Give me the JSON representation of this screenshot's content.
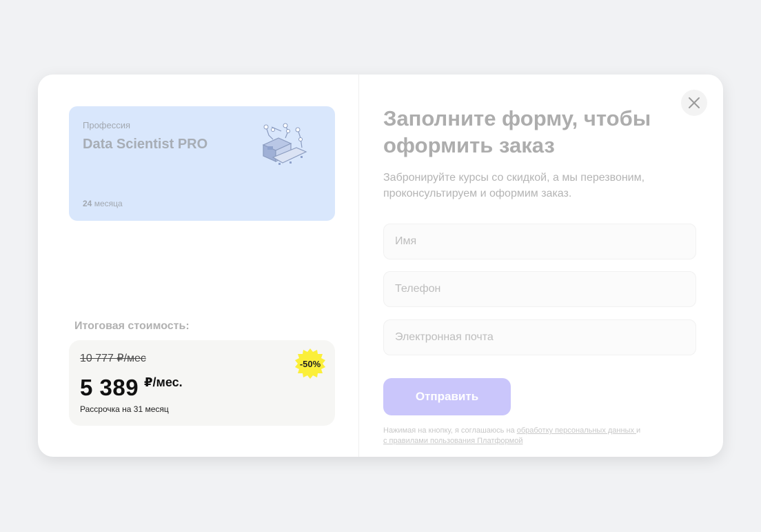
{
  "course": {
    "kicker": "Профессия",
    "title": "Data Scientist PRO",
    "duration_value": "24",
    "duration_unit": "месяца",
    "illustration_icon": "robot-arm-illustration"
  },
  "total": {
    "label": "Итоговая стоимость:",
    "old_price": "10 777 ₽/мес",
    "new_price": "5 389",
    "new_price_unit": "₽/мес.",
    "installment": "Рассрочка на 31 месяц",
    "discount": "-50%"
  },
  "form": {
    "title": "Заполните форму, чтобы оформить заказ",
    "subtitle": "Забронируйте курсы со скидкой, а мы перезвоним, проконсультируем и оформим заказ.",
    "name_placeholder": "Имя",
    "phone_placeholder": "Телефон",
    "email_placeholder": "Электронная почта",
    "submit_label": "Отправить",
    "consent_prefix": "Нажимая на кнопку, я соглашаюсь на ",
    "consent_link1": "обработку персональных данных ",
    "consent_middle": "и",
    "consent_link2": "с правилами пользования Платформой"
  },
  "colors": {
    "card_bg": "#d9e7fc",
    "badge": "#fbef3a",
    "submit": "#cac6fb"
  },
  "icons": {
    "close": "close-icon"
  }
}
